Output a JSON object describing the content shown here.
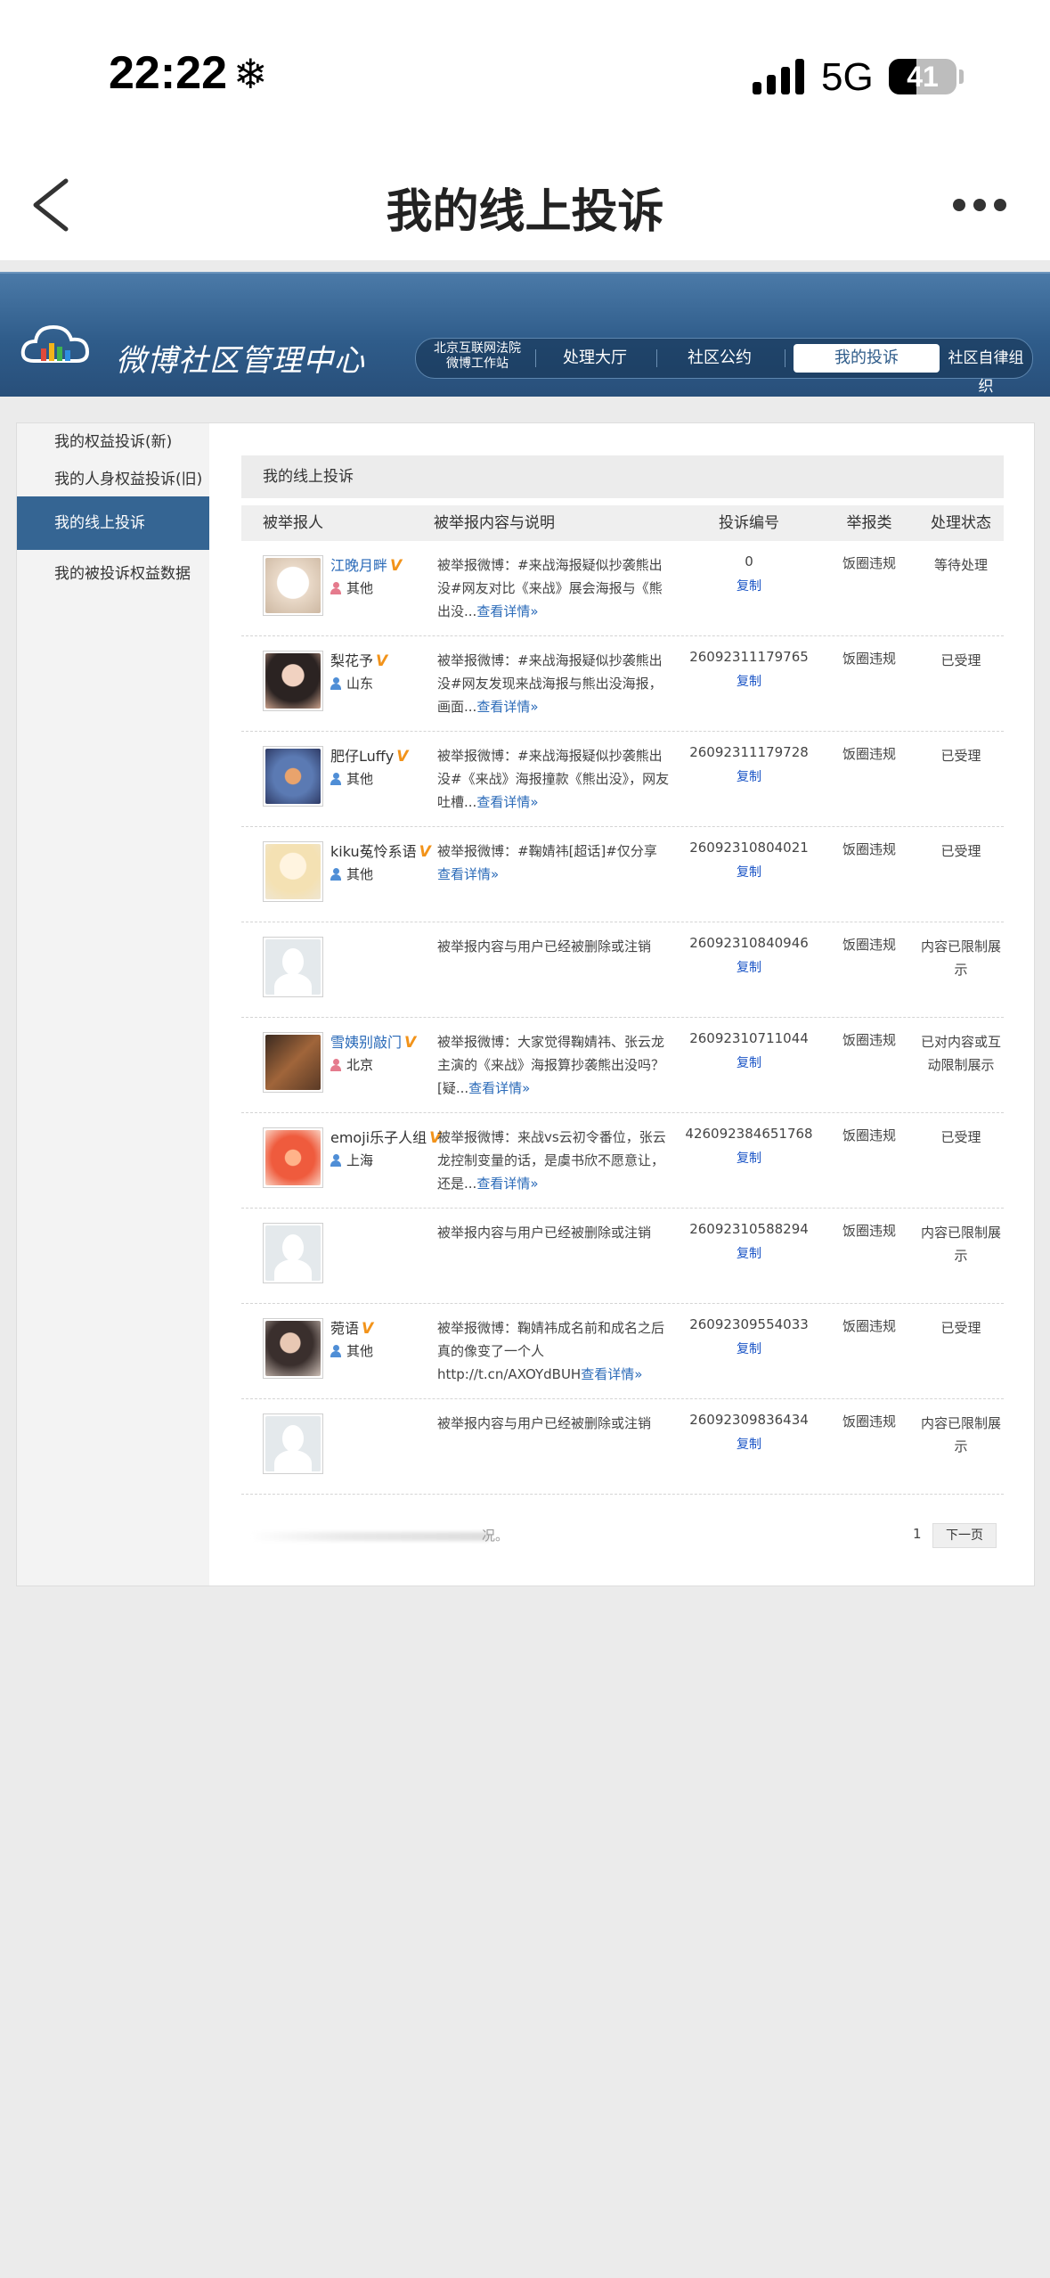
{
  "status_bar": {
    "time": "22:22",
    "time_icon": "snowflake-icon",
    "network": "5G",
    "battery": "41",
    "battery_level": 0.41
  },
  "nav": {
    "title": "我的线上投诉"
  },
  "header": {
    "logo": "微博社区管理中心",
    "sub_label_line1": "北京互联网法院",
    "sub_label_line2": "微博工作站",
    "tabs": [
      {
        "label": "处理大厅"
      },
      {
        "label": "社区公约"
      },
      {
        "label": "我的投诉"
      },
      {
        "label": "社区自律组织"
      }
    ]
  },
  "sidebar": {
    "items": [
      {
        "label": "我的权益投诉(新)"
      },
      {
        "label": "我的人身权益投诉(旧)"
      },
      {
        "label": "我的线上投诉"
      },
      {
        "label": "我的被投诉权益数据"
      }
    ]
  },
  "panel": {
    "title": "我的线上投诉",
    "columns": [
      "被举报人",
      "被举报内容与说明",
      "投诉编号",
      "举报类",
      "处理状态"
    ],
    "copy_label": "复制",
    "rows": [
      {
        "user": "江晚月畔",
        "loc": "其他",
        "gender": "f",
        "desc": "被举报微博：#来战海报疑似抄袭熊出没#网友对比《来战》展会海报与《熊出没...",
        "more": "查看详情»",
        "id": "0",
        "type": "饭圈违规",
        "status": "等待处理"
      },
      {
        "user": "梨花予",
        "loc": "山东",
        "gender": "m",
        "desc": "被举报微博：#来战海报疑似抄袭熊出没#网友发现来战海报与熊出没海报，画面...",
        "more": "查看详情»",
        "id": "26092311179765",
        "type": "饭圈违规",
        "status": "已受理"
      },
      {
        "user": "肥仔Luffy",
        "loc": "其他",
        "gender": "m",
        "desc": "被举报微博：#来战海报疑似抄袭熊出没#《来战》海报撞款《熊出没》，网友吐槽...",
        "more": "查看详情»",
        "id": "26092311179728",
        "type": "饭圈违规",
        "status": "已受理"
      },
      {
        "user": "kiku菟怜系语",
        "loc": "其他",
        "gender": "m",
        "desc": "被举报微博：#鞠婧祎[超话]#仅分享 ",
        "more": "查看详情»",
        "id": "26092310804021",
        "type": "饭圈违规",
        "status": "已受理"
      },
      {
        "user": "",
        "loc": "",
        "gender": "",
        "desc": "被举报内容与用户已经被删除或注销",
        "more": "",
        "id": "26092310840946",
        "type": "饭圈违规",
        "status": "内容已限制展示"
      },
      {
        "user": "雪姨别敲门",
        "loc": "北京",
        "gender": "f",
        "desc": "被举报微博：大家觉得鞠婧祎、张云龙主演的《来战》海报算抄袭熊出没吗？[疑...",
        "more": "查看详情»",
        "id": "26092310711044",
        "type": "饭圈违规",
        "status": "已对内容或互动限制展示"
      },
      {
        "user": "emoji乐子人组",
        "loc": "上海",
        "gender": "m",
        "desc": "被举报微博：来战vs云初令番位，张云龙控制变量的话，是虞书欣不愿意让，还是...",
        "more": "查看详情»",
        "id": "426092384651768",
        "type": "饭圈违规",
        "status": "已受理"
      },
      {
        "user": "",
        "loc": "",
        "gender": "",
        "desc": "被举报内容与用户已经被删除或注销",
        "more": "",
        "id": "26092310588294",
        "type": "饭圈违规",
        "status": "内容已限制展示"
      },
      {
        "user": "菀语",
        "loc": "其他",
        "gender": "m",
        "desc": "被举报微博：鞠婧祎成名前和成名之后真的像变了一个人 http://t.cn/AXOYdBUH",
        "more": "查看详情»",
        "id": "26092309554033",
        "type": "饭圈违规",
        "status": "已受理"
      },
      {
        "user": "",
        "loc": "",
        "gender": "",
        "desc": "被举报内容与用户已经被删除或注销",
        "more": "",
        "id": "26092309836434",
        "type": "饭圈违规",
        "status": "内容已限制展示"
      }
    ]
  },
  "footer": {
    "note_tail": "况。",
    "page": "1",
    "next": "下一页"
  }
}
